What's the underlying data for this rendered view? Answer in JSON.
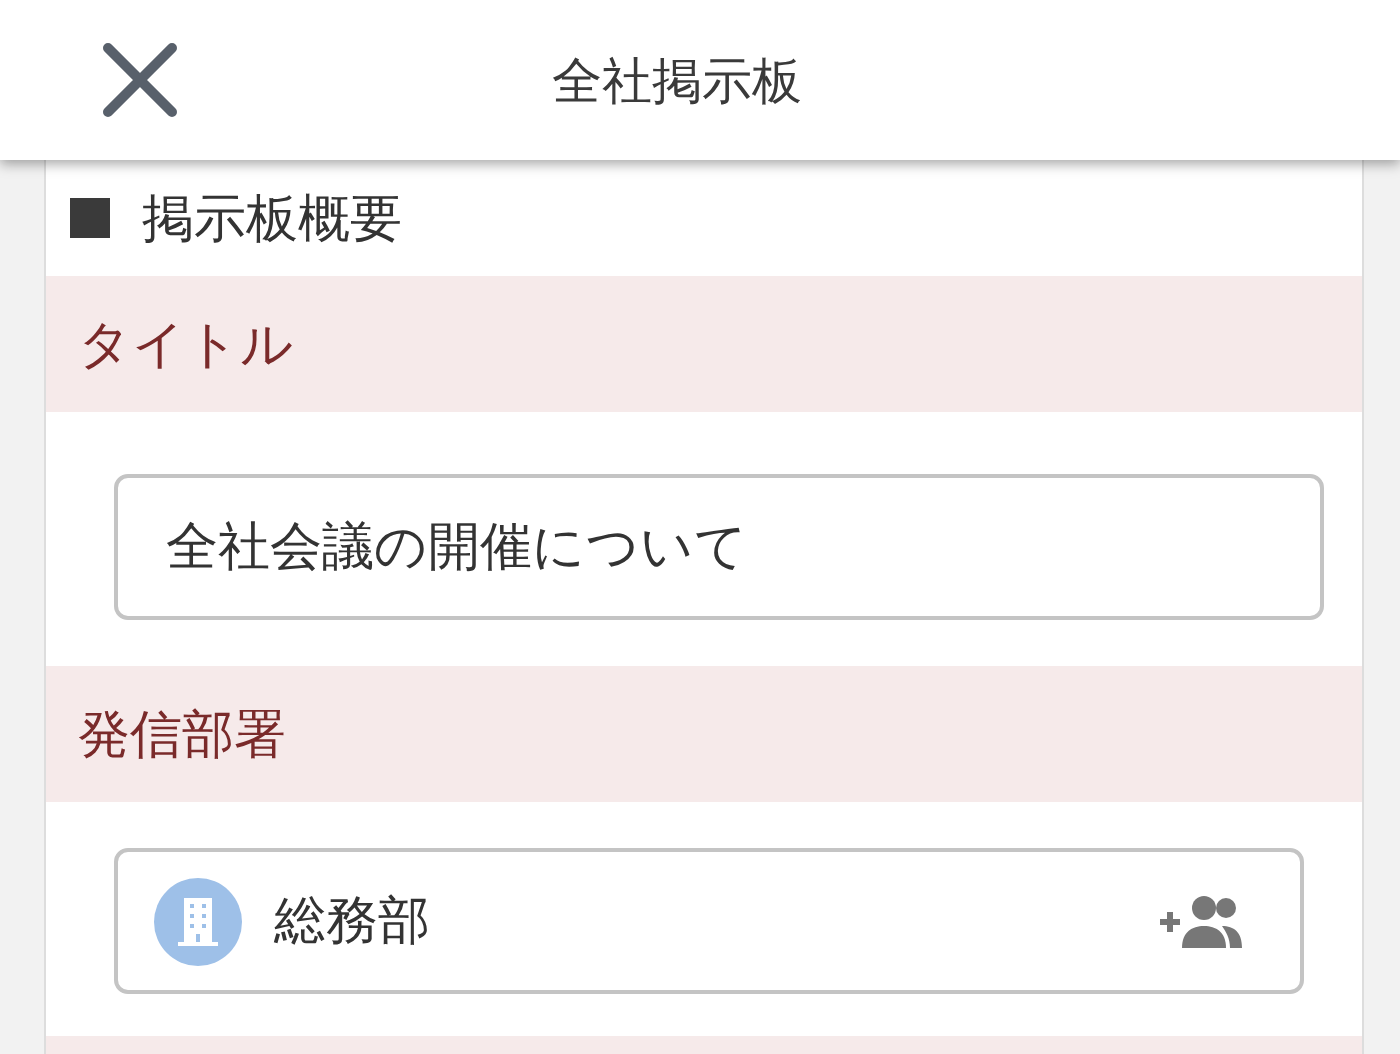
{
  "header": {
    "title": "全社掲示板"
  },
  "section": {
    "heading": "掲示板概要"
  },
  "fields": [
    {
      "label": "タイトル",
      "kind": "text",
      "value": "全社会議の開催について"
    },
    {
      "label": "発信部署",
      "kind": "department",
      "value": "総務部"
    }
  ]
}
